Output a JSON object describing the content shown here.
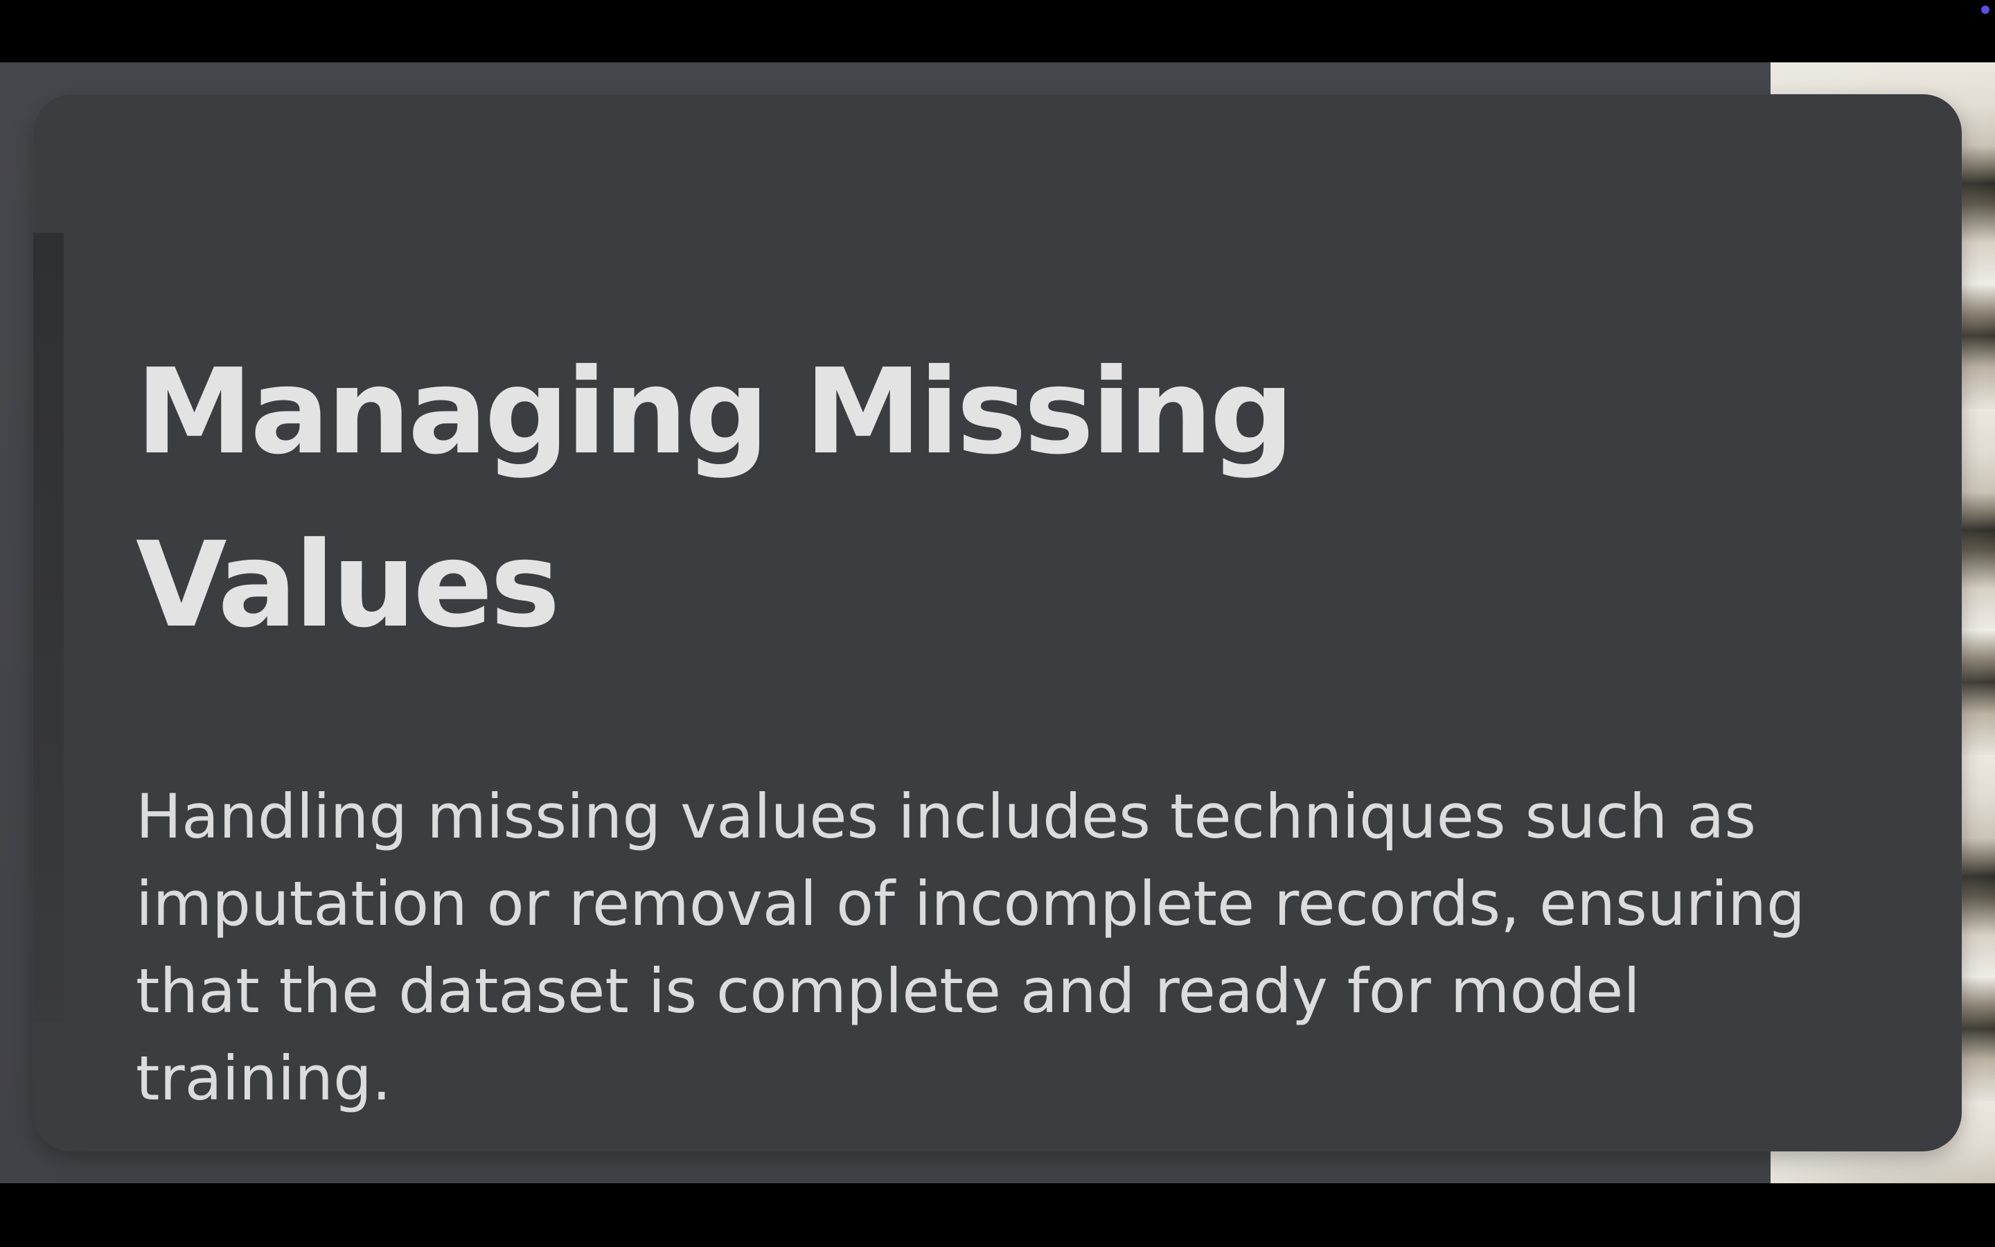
{
  "slide": {
    "title": "Managing Missing Values",
    "body": "Handling missing values includes techniques such as imputation or removal of incomplete records, ensuring that the dataset is complete and ready for model training."
  },
  "colors": {
    "card_background": "#3c3d41",
    "stage_background": "#45464b",
    "text_primary": "#e3e3e4",
    "letterbox": "#000000",
    "status_dot": "#5b4fe0"
  }
}
